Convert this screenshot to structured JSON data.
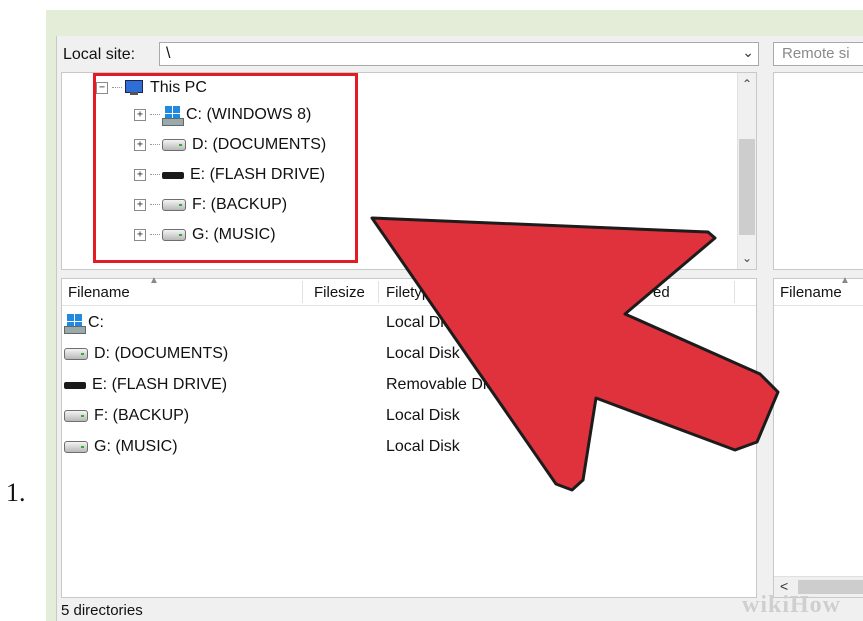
{
  "step_number": "1.",
  "local_site": {
    "label": "Local site:",
    "path": "\\",
    "dropdown_icon": "chevron-down-icon"
  },
  "remote_site": {
    "label": "Remote si"
  },
  "tree": {
    "root": {
      "label": "This PC",
      "icon": "computer-icon",
      "expanded": true
    },
    "drives": [
      {
        "label": "C: (WINDOWS 8)",
        "icon": "windows-drive-icon"
      },
      {
        "label": "D: (DOCUMENTS)",
        "icon": "hard-drive-icon"
      },
      {
        "label": "E: (FLASH DRIVE)",
        "icon": "flash-drive-icon"
      },
      {
        "label": "F: (BACKUP)",
        "icon": "hard-drive-icon"
      },
      {
        "label": "G: (MUSIC)",
        "icon": "hard-drive-icon"
      }
    ]
  },
  "file_list": {
    "columns": {
      "filename": "Filename",
      "filesize": "Filesize",
      "filetype": "Filetyp",
      "modified": "ed"
    },
    "rows": [
      {
        "name": "C:",
        "type": "Local Disk",
        "icon": "windows-drive-icon"
      },
      {
        "name": "D: (DOCUMENTS)",
        "type": "Local Disk",
        "icon": "hard-drive-icon"
      },
      {
        "name": "E: (FLASH DRIVE)",
        "type": "Removable Disk",
        "icon": "flash-drive-icon"
      },
      {
        "name": "F: (BACKUP)",
        "type": "Local Disk",
        "icon": "hard-drive-icon"
      },
      {
        "name": "G: (MUSIC)",
        "type": "Local Disk",
        "icon": "hard-drive-icon"
      }
    ]
  },
  "remote_list": {
    "columns": {
      "filename": "Filename"
    }
  },
  "status": "5 directories",
  "watermark": "wikiHow",
  "colors": {
    "highlight": "#e21b24",
    "arrow": "#e0323c",
    "frame": "#e4edd7"
  }
}
